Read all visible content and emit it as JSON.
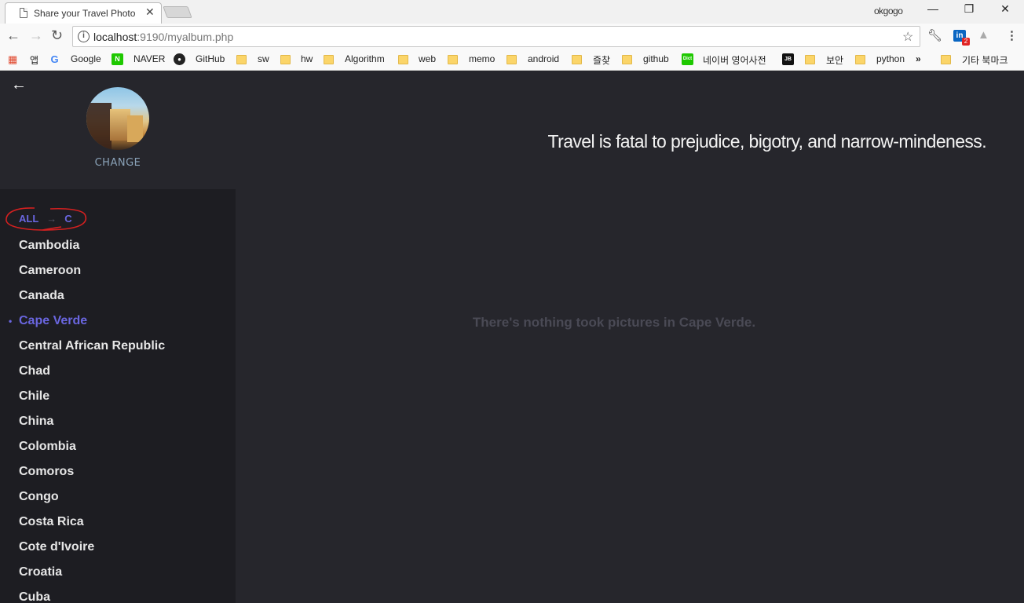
{
  "browser": {
    "tab_title": "Share your Travel Photo",
    "tab_close": "✕",
    "profile_name": "okgogo",
    "window_controls": {
      "minimize": "—",
      "restore": "❐",
      "close": "✕"
    },
    "url_host": "localhost",
    "url_rest": ":9190/myalbum.php",
    "info_glyph": "i",
    "linkedin_label": "in",
    "linkedin_badge": "2",
    "bookmarks": {
      "apps": "앱",
      "google": "Google",
      "naver": "NAVER",
      "github": "GitHub",
      "sw": "sw",
      "hw": "hw",
      "algorithm": "Algorithm",
      "web": "web",
      "memo": "memo",
      "android": "android",
      "jeulchat": "즐찾",
      "github2": "github",
      "naver_dict": "네이버 영어사전",
      "boan": "보안",
      "python": "python",
      "more": "»",
      "other": "기타 북마크"
    },
    "bookmark_icons": {
      "google": "G",
      "naver": "N",
      "dict": "Dict",
      "jb": "JB"
    }
  },
  "header": {
    "change_label": "CHANGE",
    "quote": "Travel is fatal to prejudice, bigotry, and narrow-mindeness."
  },
  "sidebar": {
    "breadcrumb": {
      "root": "ALL",
      "separator": "→",
      "current": "C"
    },
    "countries": [
      "Cambodia",
      "Cameroon",
      "Canada",
      "Cape Verde",
      "Central African Republic",
      "Chad",
      "Chile",
      "China",
      "Colombia",
      "Comoros",
      "Congo",
      "Costa Rica",
      "Cote d'Ivoire",
      "Croatia",
      "Cuba"
    ],
    "selected": "Cape Verde"
  },
  "main": {
    "empty_message": "There's nothing took pictures in Cape Verde."
  },
  "colors": {
    "page_bg": "#26262c",
    "sidebar_bg": "#1d1d22",
    "accent": "#6a66e0",
    "annotation": "#d42020"
  }
}
